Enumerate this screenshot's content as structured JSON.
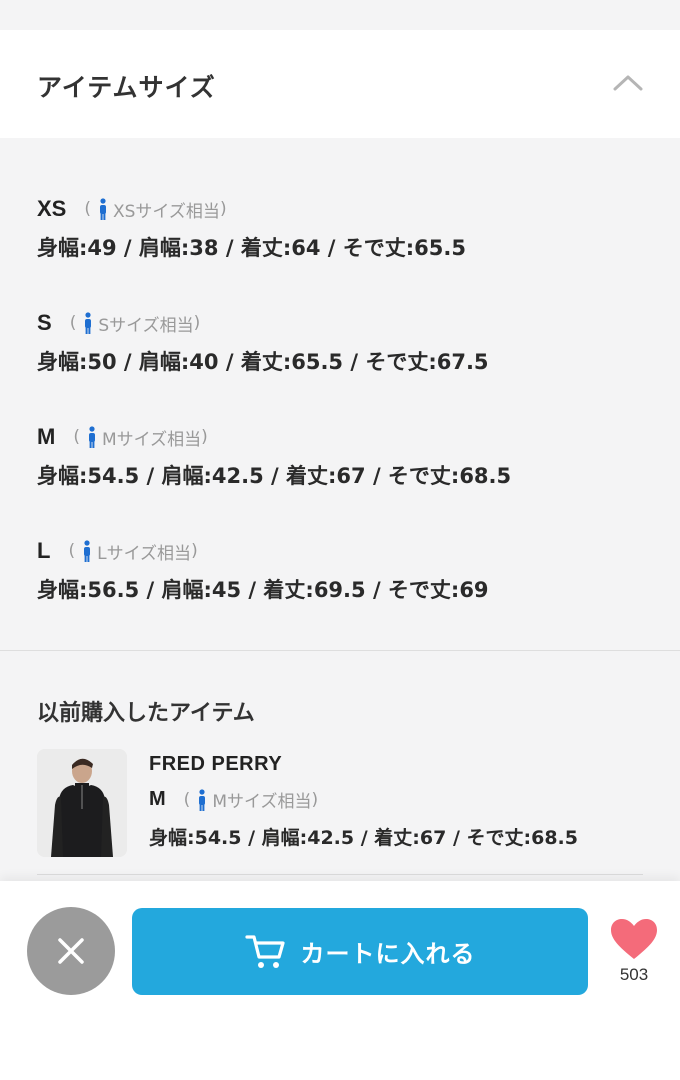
{
  "header": {
    "title": "アイテムサイズ"
  },
  "sizes": [
    {
      "label": "XS",
      "equiv": "XSサイズ相当",
      "measure": "身幅:49 / 肩幅:38 / 着丈:64 / そで丈:65.5"
    },
    {
      "label": "S",
      "equiv": "Sサイズ相当",
      "measure": "身幅:50 / 肩幅:40 / 着丈:65.5 / そで丈:67.5"
    },
    {
      "label": "M",
      "equiv": "Mサイズ相当",
      "measure": "身幅:54.5 / 肩幅:42.5 / 着丈:67 / そで丈:68.5"
    },
    {
      "label": "L",
      "equiv": "Lサイズ相当",
      "measure": "身幅:56.5 / 肩幅:45 / 着丈:69.5 / そで丈:69"
    }
  ],
  "paren_open": "(",
  "paren_close": ")",
  "previous": {
    "title": "以前購入したアイテム",
    "brand": "FRED PERRY",
    "size_label": "M",
    "equiv": "Mサイズ相当",
    "measure": "身幅:54.5 / 肩幅:42.5 / 着丈:67 / そで丈:68.5"
  },
  "bottom": {
    "cart_label": "カートに入れる",
    "favorite_count": "503"
  },
  "colors": {
    "accent": "#23a8dd",
    "heart": "#f46b7a",
    "person_icon": "#1f6fd1",
    "close_bg": "#9b9b9b"
  },
  "icons": [
    "chevron-up-icon",
    "person-icon",
    "close-icon",
    "cart-icon",
    "heart-icon"
  ]
}
